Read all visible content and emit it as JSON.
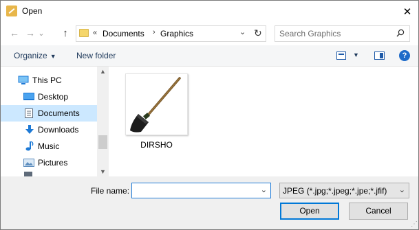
{
  "window": {
    "title": "Open",
    "close_glyph": "✕"
  },
  "nav": {
    "back_glyph": "←",
    "forward_glyph": "→",
    "recent_glyph": "⌄",
    "up_glyph": "↑",
    "breadcrumb_overflow": "«",
    "breadcrumb": [
      "Documents",
      "Graphics"
    ],
    "breadcrumb_sep": "›",
    "address_dropdown_glyph": "⌄",
    "refresh_glyph": "↻",
    "search_placeholder": "Search Graphics"
  },
  "toolbar": {
    "organize_label": "Organize",
    "new_folder_label": "New folder",
    "caret_glyph": "▼",
    "help_glyph": "?"
  },
  "sidebar": {
    "items": [
      {
        "label": "This PC",
        "icon": "computer-icon",
        "color": "#1e7ad6"
      },
      {
        "label": "Desktop",
        "icon": "desktop-icon",
        "color": "#1e7ad6"
      },
      {
        "label": "Documents",
        "icon": "documents-icon",
        "color": "#5f6b7a",
        "selected": true
      },
      {
        "label": "Downloads",
        "icon": "download-arrow-icon",
        "color": "#1e7ad6"
      },
      {
        "label": "Music",
        "icon": "music-note-icon",
        "color": "#1e7ad6"
      },
      {
        "label": "Pictures",
        "icon": "pictures-icon",
        "color": "#5f8fbf"
      }
    ],
    "scroll_up_glyph": "▲",
    "scroll_down_glyph": "▼"
  },
  "files": [
    {
      "name": "DIRSHO",
      "thumbnail": "shovel-image"
    }
  ],
  "footer": {
    "file_name_label": "File name:",
    "file_name_value": "",
    "file_name_dropdown_glyph": "⌄",
    "file_type_value": "JPEG (*.jpg;*.jpeg;*.jpe;*.jfif)",
    "file_type_dropdown_glyph": "⌄",
    "open_label": "Open",
    "cancel_label": "Cancel",
    "grip_glyph": "⋰"
  },
  "colors": {
    "accent": "#0078d7",
    "selection": "#cce8ff",
    "command_text": "#1e395b"
  }
}
